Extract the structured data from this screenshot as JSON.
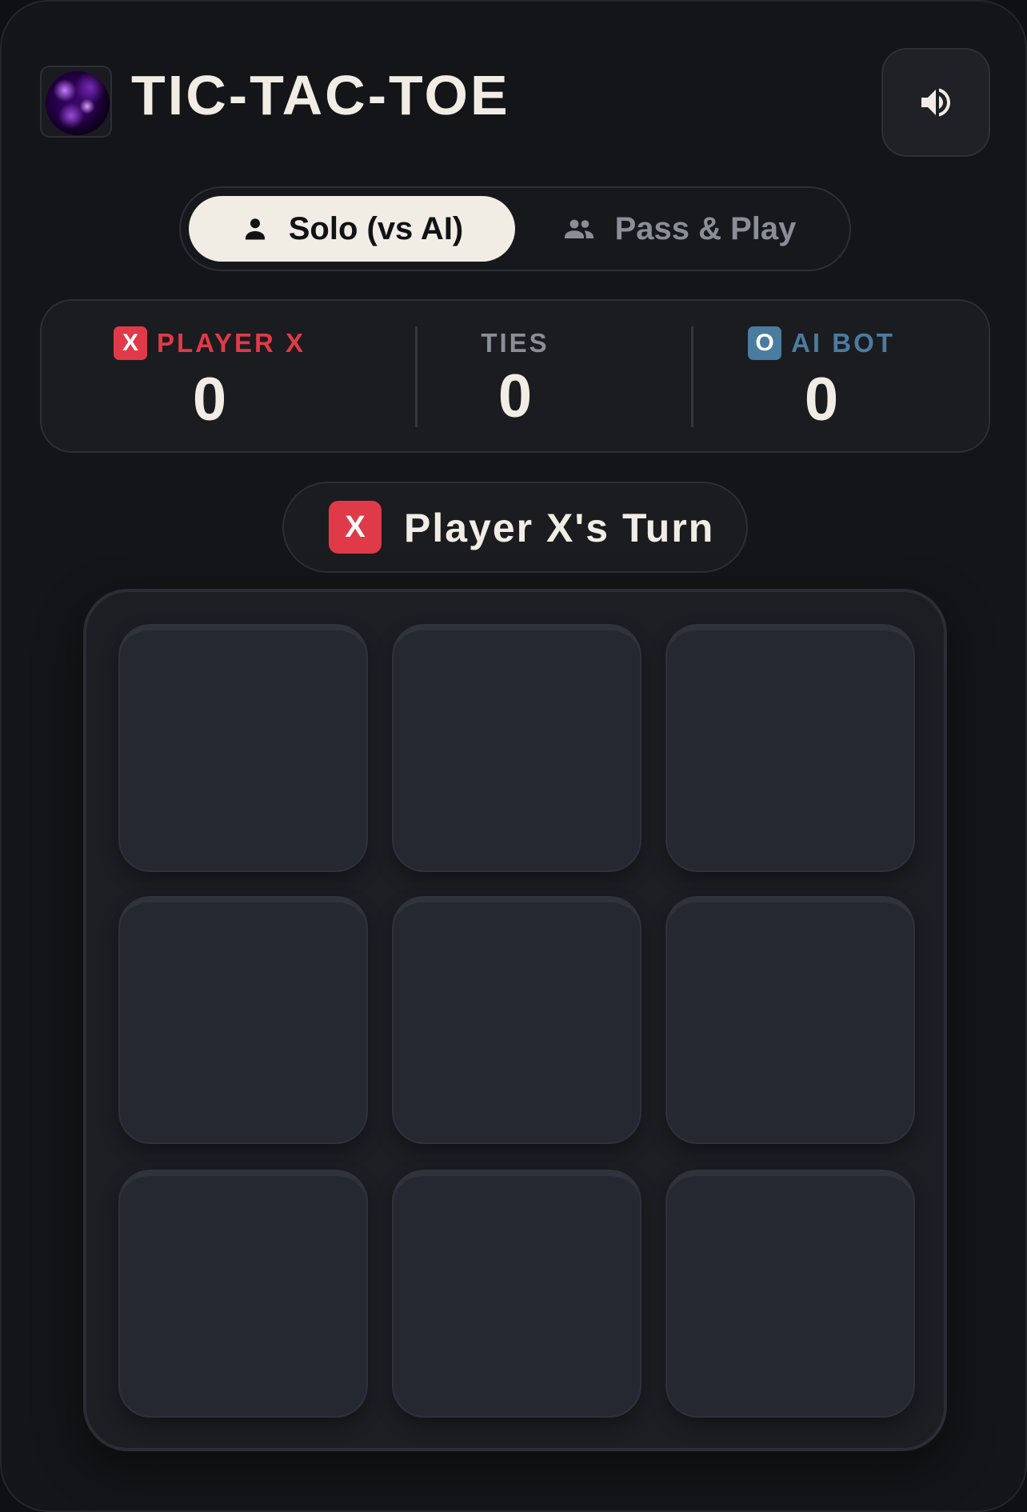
{
  "header": {
    "title": "TIC-TAC-TOE",
    "logo_icon": "galaxy-orb-icon",
    "sound_icon": "speaker-volume-icon"
  },
  "modes": {
    "solo": {
      "label": "Solo (vs AI)",
      "icon": "person-icon",
      "selected": true
    },
    "pass": {
      "label": "Pass & Play",
      "icon": "people-icon",
      "selected": false
    }
  },
  "scoreboard": {
    "player_x": {
      "badge": "X",
      "label": "PLAYER X",
      "score": "0",
      "color": "#e03a48"
    },
    "ties": {
      "label": "TIES",
      "score": "0",
      "color": "#8b8e97"
    },
    "ai_bot": {
      "badge": "O",
      "label": "AI BOT",
      "score": "0",
      "color": "#4a7ca0"
    }
  },
  "turn": {
    "badge": "X",
    "text": "Player X's Turn"
  },
  "board": {
    "cells": [
      "",
      "",
      "",
      "",
      "",
      "",
      "",
      "",
      ""
    ]
  },
  "colors": {
    "background": "#141518",
    "accent_light": "#f2ede4",
    "x_red": "#e03a48",
    "o_blue": "#4a7ca0",
    "muted": "#8b8e97"
  }
}
